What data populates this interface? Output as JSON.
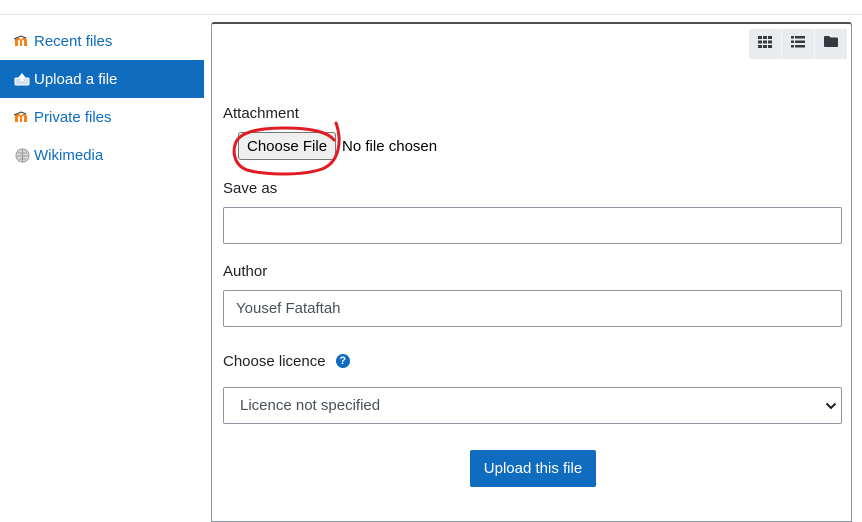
{
  "sidebar": {
    "items": [
      {
        "label": "Recent files",
        "icon": "moodle-icon",
        "active": false
      },
      {
        "label": "Upload a file",
        "icon": "upload-icon",
        "active": true
      },
      {
        "label": "Private files",
        "icon": "moodle-icon",
        "active": false
      },
      {
        "label": "Wikimedia",
        "icon": "wikipedia-globe-icon",
        "active": false
      }
    ]
  },
  "toolbar": {
    "views": [
      "icons-view-icon",
      "list-view-icon",
      "folder-tree-view-icon"
    ]
  },
  "form": {
    "attachment_label": "Attachment",
    "choose_file_label": "Choose File",
    "no_file_text": "No file chosen",
    "save_as_label": "Save as",
    "save_as_value": "",
    "author_label": "Author",
    "author_value": "Yousef Fataftah",
    "licence_label": "Choose licence",
    "licence_help": "?",
    "licence_selected": "Licence not specified",
    "upload_button": "Upload this file"
  },
  "colors": {
    "accent": "#0f6cbf",
    "annotation": "#e01b24"
  }
}
